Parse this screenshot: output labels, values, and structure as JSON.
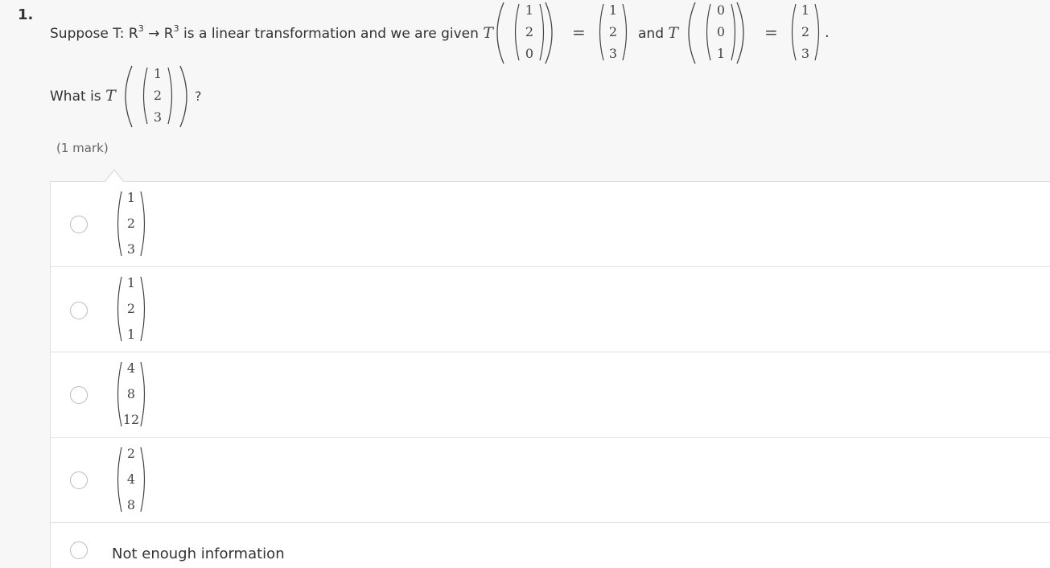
{
  "question": {
    "number": "1.",
    "intro": "Suppose T: R",
    "sup1": "3",
    "arrow": " → R",
    "sup2": "3",
    "middle": " is a linear transformation and we are given ",
    "T_symbol": "T",
    "equals": "=",
    "and_text": "and",
    "period": ".",
    "v1": [
      "1",
      "2",
      "0"
    ],
    "r1": [
      "1",
      "2",
      "3"
    ],
    "v2": [
      "0",
      "0",
      "1"
    ],
    "r2": [
      "1",
      "2",
      "3"
    ],
    "what_is": "What is",
    "qv": [
      "1",
      "2",
      "3"
    ],
    "qmark": "?",
    "marks": "(1 mark)"
  },
  "options": [
    {
      "vector": [
        "1",
        "2",
        "3"
      ]
    },
    {
      "vector": [
        "1",
        "2",
        "1"
      ]
    },
    {
      "vector": [
        "4",
        "8",
        "12"
      ]
    },
    {
      "vector": [
        "2",
        "4",
        "8"
      ]
    },
    {
      "text": "Not enough information"
    }
  ]
}
